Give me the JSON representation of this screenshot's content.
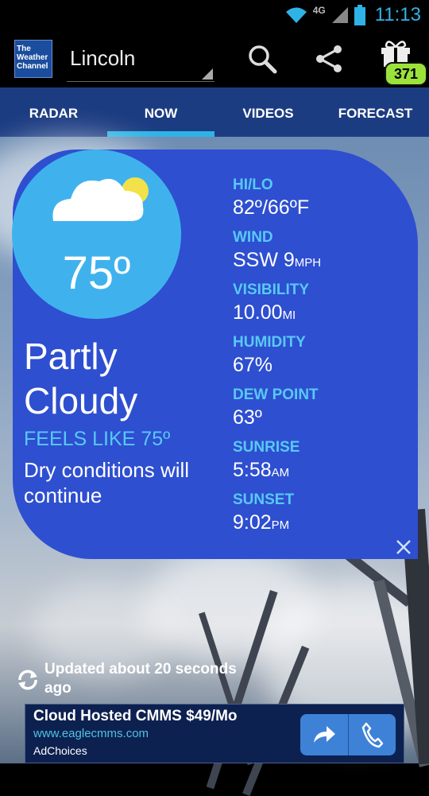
{
  "status_bar": {
    "time": "11:13",
    "network": "4G"
  },
  "header": {
    "logo_text": "The Weather Channel",
    "city": "Lincoln",
    "badge_count": "371"
  },
  "tabs": [
    {
      "label": "RADAR",
      "active": false
    },
    {
      "label": "NOW",
      "active": true
    },
    {
      "label": "VIDEOS",
      "active": false
    },
    {
      "label": "FORECAST",
      "active": false
    }
  ],
  "current": {
    "temperature": "75º",
    "condition": "Partly Cloudy",
    "feels_like": "FEELS LIKE 75º",
    "description": "Dry conditions will continue"
  },
  "stats": {
    "hilo": {
      "label": "HI/LO",
      "value": "82º/66ºF",
      "unit": ""
    },
    "wind": {
      "label": "WIND",
      "value": "SSW 9",
      "unit": "MPH"
    },
    "visibility": {
      "label": "VISIBILITY",
      "value": "10.00",
      "unit": "MI"
    },
    "humidity": {
      "label": "HUMIDITY",
      "value": "67%",
      "unit": ""
    },
    "dew_point": {
      "label": "DEW POINT",
      "value": "63º",
      "unit": ""
    },
    "sunrise": {
      "label": "SUNRISE",
      "value": "5:58",
      "unit": "AM"
    },
    "sunset": {
      "label": "SUNSET",
      "value": "9:02",
      "unit": "PM"
    }
  },
  "updated_text": "Updated about 20 seconds ago",
  "ad": {
    "title": "Cloud Hosted CMMS $49/Mo",
    "url": "www.eaglecmms.com",
    "choices": "AdChoices"
  },
  "colors": {
    "tab_bar": "#1c3c82",
    "accent": "#2fb3e6",
    "card": "#2e4fd0",
    "label_blue": "#58c9f5",
    "badge": "#9be33a"
  }
}
